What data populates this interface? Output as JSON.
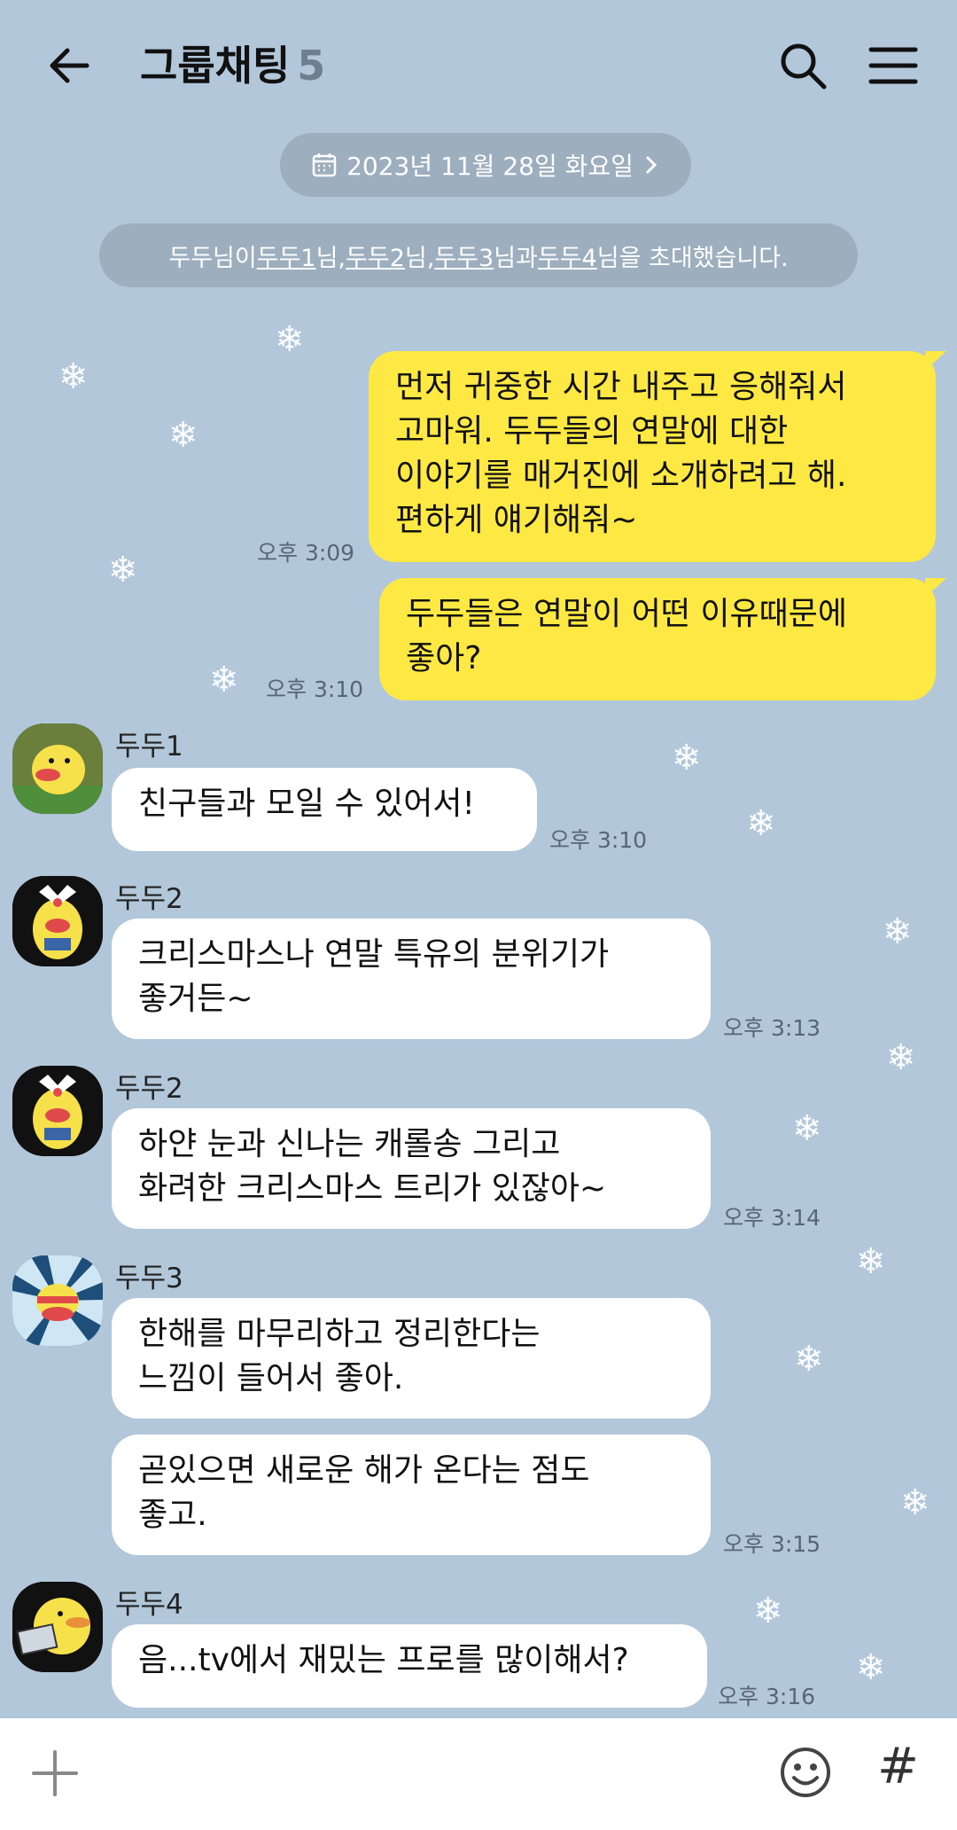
{
  "header": {
    "title": "그룹채팅",
    "member_count": "5"
  },
  "date_divider": "2023년 11월 28일 화요일",
  "system_message": {
    "inviter": "두두",
    "p1": "님이 ",
    "u1": "두두1",
    "p2": "님, ",
    "u2": "두두2",
    "p3": "님, ",
    "u3": "두두3",
    "p4": "님과 ",
    "u4": "두두4",
    "p5": "님을 초대했습니다."
  },
  "messages": [
    {
      "sender": "me",
      "text": "먼저 귀중한 시간 내주고 응해줘서\n고마워. 두두들의 연말에 대한\n이야기를 매거진에 소개하려고 해.\n편하게 얘기해줘~",
      "time": "오후 3:09"
    },
    {
      "sender": "me",
      "text": "두두들은 연말이 어떤 이유때문에\n좋아?",
      "time": "오후 3:10"
    },
    {
      "sender": "두두1",
      "text": "친구들과 모일 수 있어서!",
      "time": "오후 3:10"
    },
    {
      "sender": "두두2",
      "text": "크리스마스나 연말 특유의 분위기가\n좋거든~",
      "time": "오후 3:13"
    },
    {
      "sender": "두두2",
      "text": "하얀 눈과 신나는 캐롤송 그리고\n화려한 크리스마스 트리가 있잖아~",
      "time": "오후 3:14"
    },
    {
      "sender": "두두3",
      "text": "한해를 마무리하고 정리한다는\n느낌이 들어서 좋아.",
      "time": ""
    },
    {
      "sender": "두두3",
      "text": "곧있으면 새로운 해가 온다는 점도\n좋고.",
      "time": "오후 3:15"
    },
    {
      "sender": "두두4",
      "text": "음...tv에서 재밌는 프로를 많이해서?",
      "time": "오후 3:16"
    }
  ],
  "colors": {
    "background": "#b2c7da",
    "my_bubble": "#fee843",
    "other_bubble": "#ffffff",
    "pill": "#9daebe"
  },
  "icons": [
    "back-arrow-icon",
    "search-icon",
    "menu-icon",
    "calendar-icon",
    "chevron-right-icon",
    "plus-icon",
    "emoji-icon",
    "hash-icon",
    "snowflake-icon"
  ],
  "footer": {
    "hash": "#"
  }
}
